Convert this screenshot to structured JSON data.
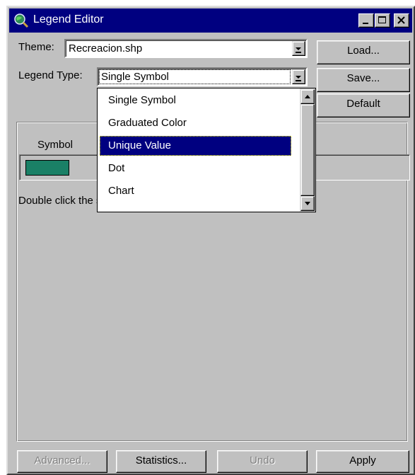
{
  "window": {
    "title": "Legend Editor",
    "icons": {
      "app": "globe-magnifier-icon",
      "minimize": "minimize-icon",
      "maximize": "maximize-icon",
      "close": "close-icon"
    }
  },
  "theme": {
    "label": "Theme:",
    "value": "Recreacion.shp"
  },
  "legend_type": {
    "label": "Legend Type:",
    "value": "Single Symbol",
    "options": [
      "Single Symbol",
      "Graduated Color",
      "Unique Value",
      "Dot",
      "Chart"
    ],
    "highlighted": "Unique Value"
  },
  "side_buttons": {
    "load": "Load...",
    "save": "Save...",
    "default": "Default"
  },
  "panel": {
    "symbol_header": "Symbol",
    "symbol_color": "#1a8066",
    "hint": "Double click the symbol to edit."
  },
  "bottom_buttons": {
    "advanced": "Advanced...",
    "statistics": "Statistics...",
    "undo": "Undo",
    "apply": "Apply"
  },
  "colors": {
    "titlebar": "#000080",
    "face": "#c0c0c0",
    "selection": "#000080"
  }
}
